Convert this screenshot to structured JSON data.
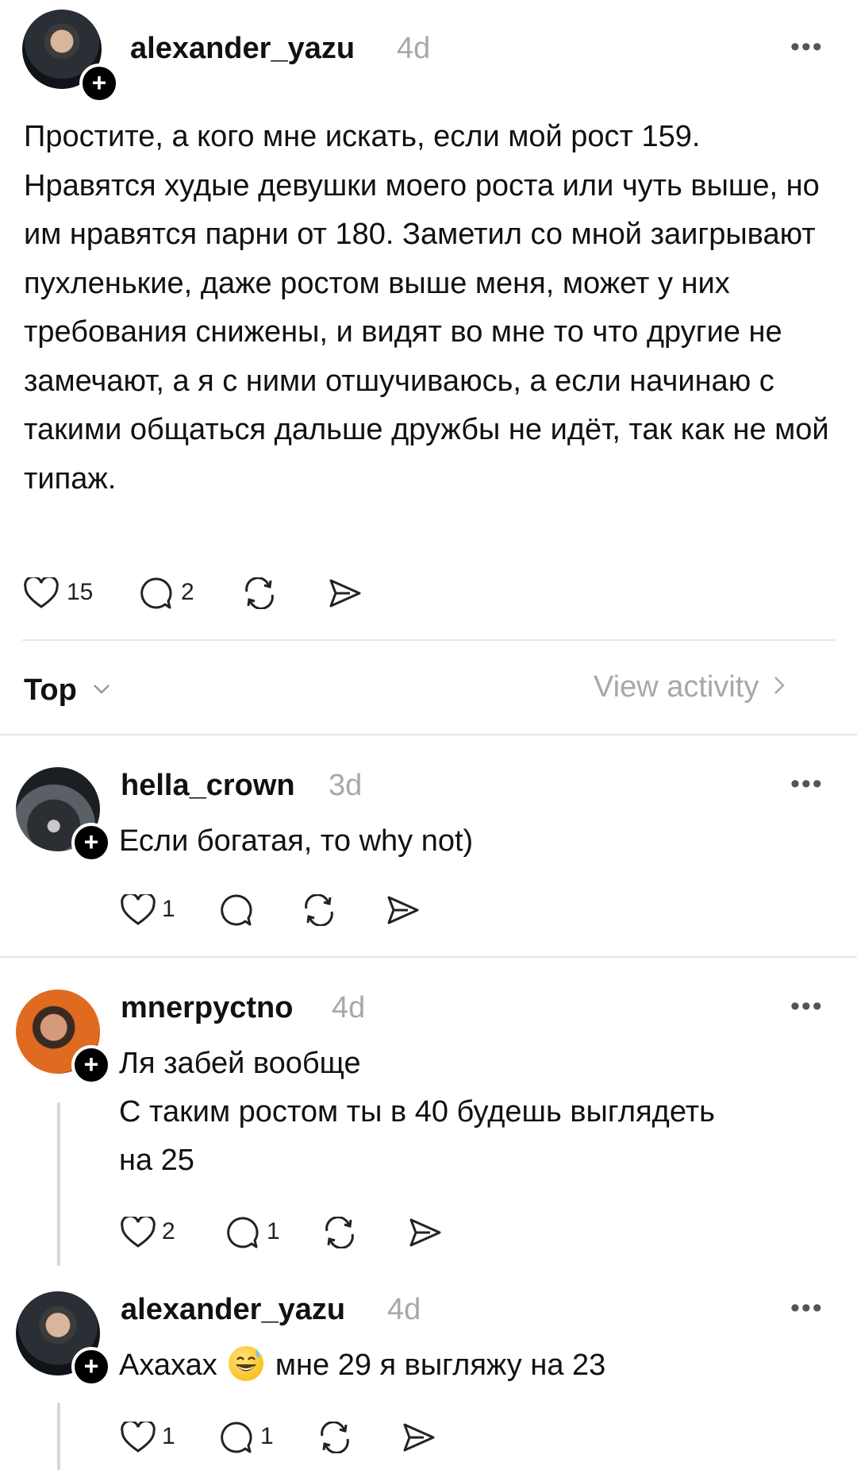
{
  "post": {
    "username": "alexander_yazu",
    "time": "4d",
    "text": "Простите, а кого мне искать, если мой рост 159. Нравятся худые девушки моего роста или чуть выше, но им нравятся парни от 180. Заметил со мной заигрывают пухленькие, даже ростом выше меня, может у них требования снижены, и видят во мне то что другие не замечают, а я с ними отшучиваюсь, а если начинаю с такими общаться дальше дружбы не идёт, так как не мой типаж.",
    "likes": "15",
    "replies": "2"
  },
  "sort": {
    "label": "Top",
    "view_activity": "View activity"
  },
  "comments": [
    {
      "username": "hella_crown",
      "time": "3d",
      "text": "Если богатая, то why not)",
      "likes": "1",
      "replies": ""
    },
    {
      "username": "mnerpyctno",
      "time": "4d",
      "lines": [
        "Ля забей вообще",
        "С таким ростом ты в 40 будешь выглядеть",
        "на 25"
      ],
      "likes": "2",
      "replies": "1"
    },
    {
      "username": "alexander_yazu",
      "time": "4d",
      "text_before": "Ахахах",
      "emoji": "grinning-sweat-emoji",
      "text_after": "мне 29 я выгляжу на 23",
      "likes": "1",
      "replies": "1"
    }
  ],
  "icons": [
    "heart-icon",
    "comment-icon",
    "repost-icon",
    "share-icon",
    "more-icon",
    "plus-icon",
    "chevron-down-icon",
    "chevron-right-icon"
  ]
}
